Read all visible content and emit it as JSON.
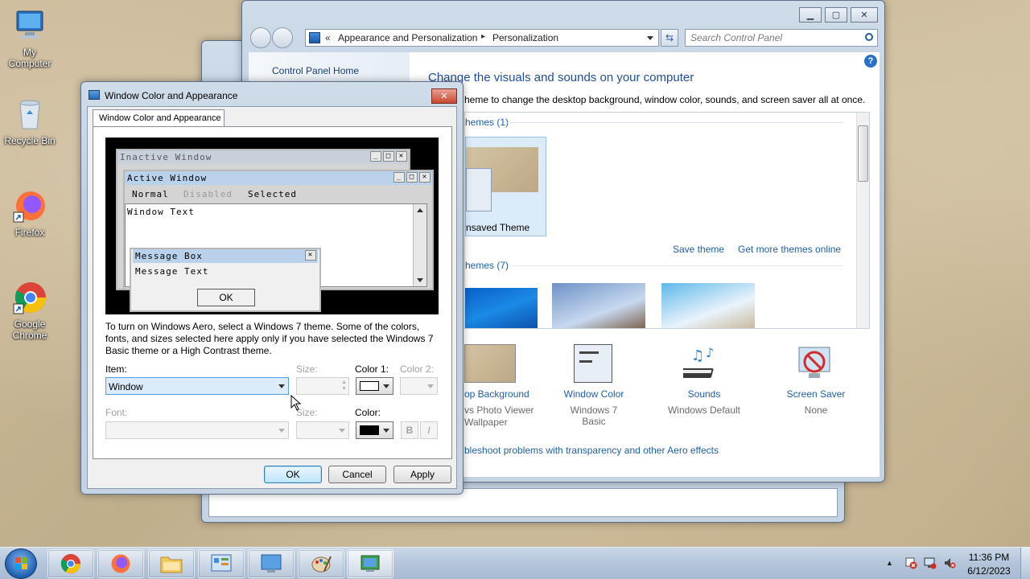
{
  "desktop": {
    "icons": [
      {
        "label_line1": "My",
        "label_line2": "Computer",
        "icon": "computer-icon"
      },
      {
        "label_line1": "Recycle Bin",
        "label_line2": "",
        "icon": "recycle-bin-icon"
      },
      {
        "label_line1": "Firefox",
        "label_line2": "",
        "icon": "firefox-icon"
      },
      {
        "label_line1": "Google",
        "label_line2": "Chrome",
        "icon": "chrome-icon"
      }
    ]
  },
  "control_panel": {
    "breadcrumb_root": "«",
    "breadcrumb_1": "Appearance and Personalization",
    "breadcrumb_sep": "▸",
    "breadcrumb_2": "Personalization",
    "search_placeholder": "Search Control Panel",
    "home_link": "Control Panel Home",
    "heading": "Change the visuals and sounds on your computer",
    "subtext": "heme to change the desktop background, window color, sounds, and screen saver all at once.",
    "my_themes": "hemes (1)",
    "unsaved_theme": "nsaved Theme",
    "save_theme": "Save theme",
    "get_more": "Get more themes online",
    "aero_themes": "hemes (7)",
    "bottom_items": [
      {
        "title": "op Background",
        "sub": "vs Photo Viewer",
        "sub2": "Wallpaper"
      },
      {
        "title": "Window Color",
        "sub": "Windows 7 Basic",
        "sub2": ""
      },
      {
        "title": "Sounds",
        "sub": "Windows Default",
        "sub2": ""
      },
      {
        "title": "Screen Saver",
        "sub": "None",
        "sub2": ""
      }
    ],
    "troubleshoot": "bleshoot problems with transparency and other Aero effects"
  },
  "dialog": {
    "title": "Window Color and Appearance",
    "tab": "Window Color and Appearance",
    "preview": {
      "inactive": "Inactive Window",
      "active": "Active Window",
      "menu_normal": "Normal",
      "menu_disabled": "Disabled",
      "menu_selected": "Selected",
      "window_text": "Window Text",
      "msgbox_title": "Message Box",
      "msgbox_text": "Message Text",
      "msgbox_ok": "OK"
    },
    "info": "To turn on Windows Aero, select a Windows 7 theme.  Some of the colors, fonts, and sizes selected here apply only if you have selected the Windows 7 Basic theme or a High Contrast theme.",
    "item_label": "Item:",
    "item_value": "Window",
    "size_label": "Size:",
    "color1_label": "Color 1:",
    "color2_label": "Color 2:",
    "font_label": "Font:",
    "font_size_label": "Size:",
    "color_label": "Color:",
    "bold": "B",
    "italic": "I",
    "ok": "OK",
    "cancel": "Cancel",
    "apply": "Apply",
    "color1_value": "#ffffff",
    "font_color_value": "#000000"
  },
  "taskbar": {
    "time": "11:36 PM",
    "date": "6/12/2023"
  }
}
